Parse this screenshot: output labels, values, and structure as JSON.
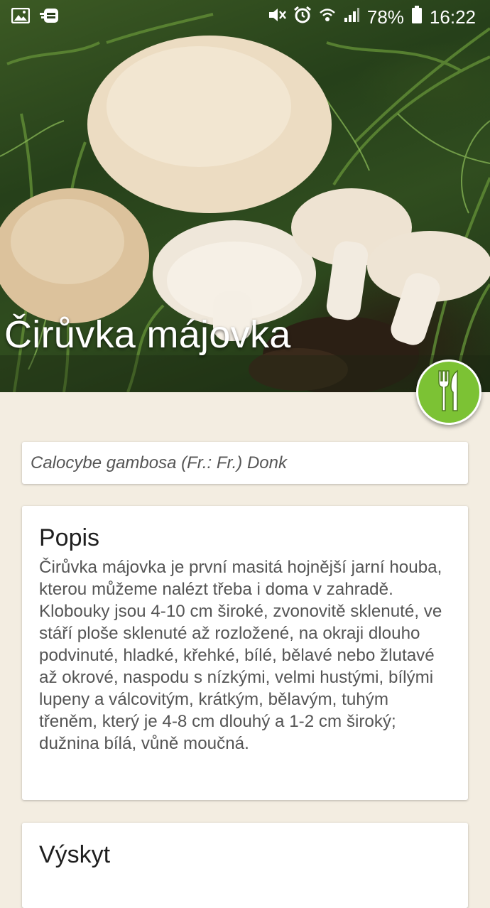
{
  "status_bar": {
    "battery": "78%",
    "time": "16:22",
    "icons": [
      "image-icon",
      "notification-icon",
      "mute-icon",
      "alarm-icon",
      "wifi-icon",
      "signal-icon",
      "battery-icon"
    ]
  },
  "header": {
    "title": "Čirůvka májovka"
  },
  "fab": {
    "icon": "fork-knife-icon",
    "color": "#7cc234"
  },
  "latin_name": "Calocybe gambosa (Fr.: Fr.) Donk",
  "sections": [
    {
      "heading": "Popis",
      "body": "Čirůvka májovka je první masitá hojnější jarní houba, kterou můžeme nalézt třeba i doma v zahradě. Klobouky jsou 4-10 cm široké, zvonovitě sklenuté, ve stáří ploše sklenuté až rozložené, na okraji dlouho podvinuté, hladké, křehké, bílé, bělavé nebo žlutavé až okrové, naspodu s nízkými, velmi hustými, bílými lupeny a válcovitým, krátkým, bělavým, tuhým třeněm, který je 4-8 cm dlouhý a 1-2 cm široký; dužnina bílá, vůně moučná."
    },
    {
      "heading": "Výskyt"
    }
  ],
  "colors": {
    "background": "#f3ede1",
    "card": "#ffffff",
    "accent_green": "#7cc234"
  }
}
